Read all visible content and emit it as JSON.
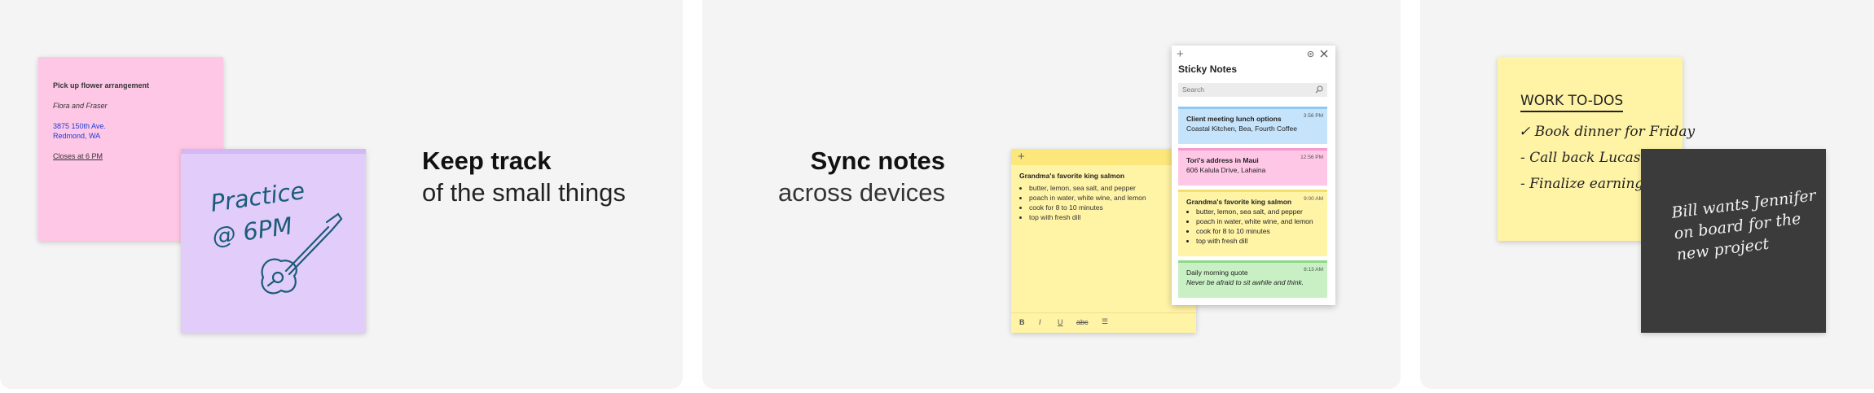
{
  "panel1": {
    "pink_note": {
      "title": "Pick up flower arrangement",
      "subtitle": "Flora and Fraser",
      "address_line1": "3875 150th Ave.",
      "address_line2": "Redmond, WA",
      "closes": "Closes at 6 PM"
    },
    "purple_note": {
      "handwriting_line1": "Practice",
      "handwriting_line2": "@ 6PM",
      "drawing": "guitar-drawing"
    },
    "headline": "Keep track",
    "subline": "of the small things"
  },
  "panel2": {
    "headline": "Sync notes",
    "subline": "across devices",
    "open_note": {
      "title": "Grandma's favorite king salmon",
      "items": [
        "butter, lemon, sea salt, and pepper",
        "poach in water, white wine, and lemon",
        "cook for 8 to 10 minutes",
        "top with fresh dill"
      ],
      "toolbar": [
        "B",
        "I",
        "U",
        "abc",
        "☰"
      ]
    },
    "list_window": {
      "title": "Sticky Notes",
      "search_placeholder": "Search",
      "notes": [
        {
          "title": "Client meeting lunch options",
          "body": "Coastal Kitchen, Bea, Fourth Coffee",
          "time": "3:56 PM",
          "color": "#c5e3fb",
          "strip": "#8fc8f2"
        },
        {
          "title": "Tori's address in Maui",
          "body": "606 Kalula Drive, Lahaina",
          "time": "12:56 PM",
          "color": "#ffc7e6",
          "strip": "#f59ad0"
        },
        {
          "title": "Grandma's favorite king salmon",
          "items": [
            "butter, lemon, sea salt, and pepper",
            "poach in water, white wine, and lemon",
            "cook for 8 to 10 minutes",
            "top with fresh dill"
          ],
          "time": "9:00 AM",
          "color": "#fff3a6",
          "strip": "#f3df6a"
        },
        {
          "title": "Daily morning quote",
          "body": "Never be afraid to sit awhile and think.",
          "time": "8:13 AM",
          "color": "#c8f0c4",
          "strip": "#8fd886"
        }
      ]
    }
  },
  "panel3": {
    "yellow_note": {
      "heading": "WORK TO-DOS",
      "lines": [
        "✓ Book dinner for Friday",
        "- Call back Lucas",
        "- Finalize earnings rep"
      ]
    },
    "dark_note": {
      "lines": [
        "Bill wants Jennifer",
        "on board for the",
        "new project"
      ]
    }
  },
  "colors": {
    "pink": "#ffc7e6",
    "purple": "#e2cdfa",
    "yellow": "#fff3a6",
    "blue": "#c5e3fb",
    "green": "#c8f0c4",
    "dark": "#3b3b3b",
    "panel_bg": "#f4f4f4"
  }
}
